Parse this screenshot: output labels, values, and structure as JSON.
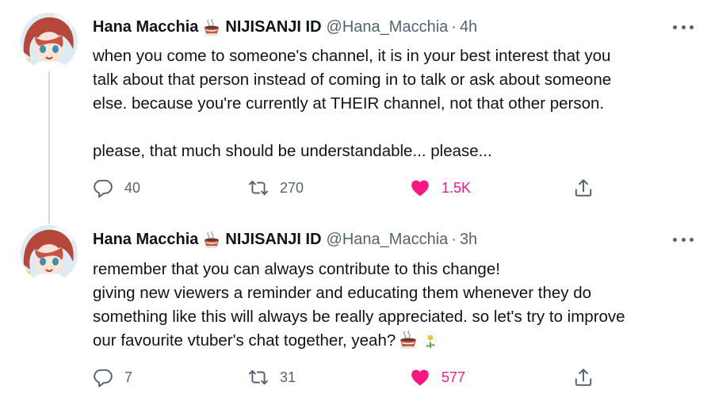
{
  "tweets": [
    {
      "author": {
        "display_name": "Hana Macchia",
        "name_suffix": "NIJISANJI ID",
        "handle": "@Hana_Macchia",
        "separator": "·"
      },
      "time": "4h",
      "lines": [
        "when you come to someone's channel, it is in your best interest that you",
        "talk about that person instead of coming in to talk or ask about someone",
        "else. because you're currently at THEIR channel, not that other person.",
        "",
        "please, that much should be understandable... please..."
      ],
      "stats": {
        "replies": "40",
        "retweets": "270",
        "likes": "1.5K"
      },
      "icons": {
        "reply": "reply-icon",
        "retweet": "retweet-icon",
        "like": "heart-icon",
        "share": "share-icon",
        "more": "more-icon"
      }
    },
    {
      "author": {
        "display_name": "Hana Macchia",
        "name_suffix": "NIJISANJI ID",
        "handle": "@Hana_Macchia",
        "separator": "·"
      },
      "time": "3h",
      "lines": [
        "remember that you can always contribute to this change!",
        "giving new viewers a reminder and educating them whenever they do",
        "something like this will always be really appreciated. so let's try to improve",
        "our favourite vtuber's chat together, yeah?"
      ],
      "trailing_emojis": [
        "coffee-emoji",
        "flower-emoji"
      ],
      "stats": {
        "replies": "7",
        "retweets": "31",
        "likes": "577"
      },
      "icons": {
        "reply": "reply-icon",
        "retweet": "retweet-icon",
        "like": "heart-icon",
        "share": "share-icon",
        "more": "more-icon"
      }
    }
  ],
  "colors": {
    "text": "#0f1419",
    "secondary": "#536471",
    "like": "#f91880",
    "thread_line": "#cfd9de"
  }
}
